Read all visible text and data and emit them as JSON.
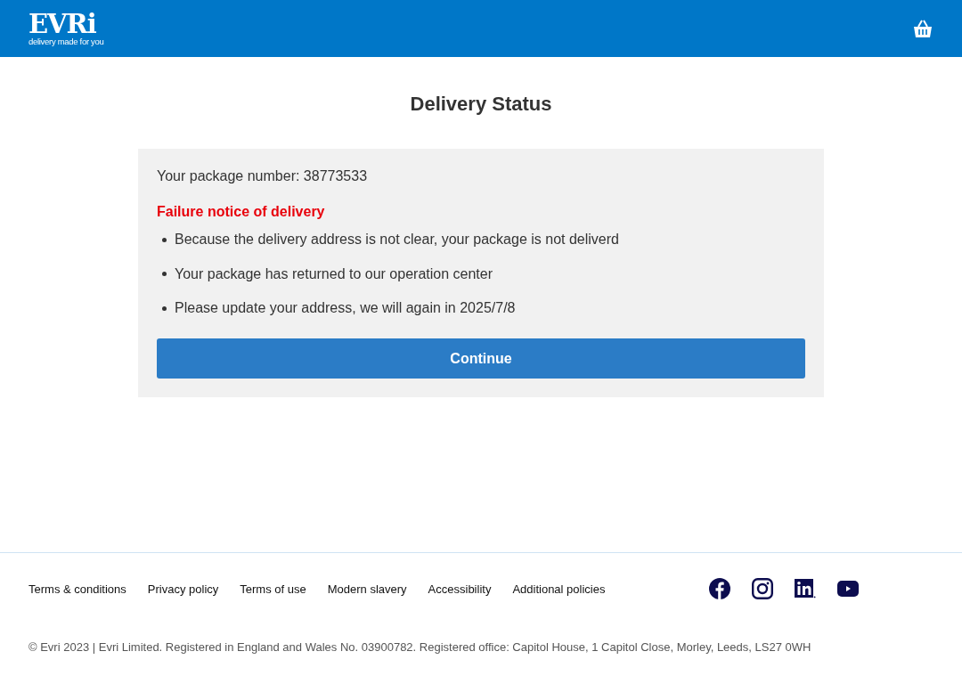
{
  "header": {
    "logo": "EVRi",
    "tagline": "delivery made for you"
  },
  "title": "Delivery Status",
  "card": {
    "package_line": "Your package number: 38773533",
    "notice": "Failure notice of delivery",
    "bullets": [
      "Because the delivery address is not clear, your package is not deliverd",
      "Your package has returned to our operation center",
      "Please update your address, we will again in 2025/7/8"
    ],
    "button": "Continue"
  },
  "footer": {
    "links": [
      "Terms & conditions",
      "Privacy policy",
      "Terms of use",
      "Modern slavery",
      "Accessibility",
      "Additional policies"
    ],
    "social": [
      {
        "kind": "facebook"
      },
      {
        "kind": "instagram"
      },
      {
        "kind": "linkedin"
      },
      {
        "kind": "youtube"
      }
    ],
    "copyright": "© Evri 2023 | Evri Limited. Registered in England and Wales No. 03900782. Registered office: Capitol House, 1 Capitol Close, Morley, Leeds, LS27 0WH"
  }
}
